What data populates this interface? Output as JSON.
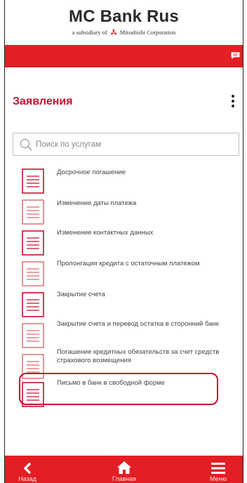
{
  "header": {
    "brand": "MC Bank Rus",
    "tagline_prefix": "a subsidiary of",
    "tagline_company": "Mitsubishi Corporation",
    "accent_color": "#e31e24"
  },
  "page": {
    "title": "Заявления",
    "menu_icon": "kebab-menu-icon"
  },
  "search": {
    "placeholder": "Поиск по услугам",
    "icon": "search-icon"
  },
  "applications": [
    {
      "label": "Досрочное погашение"
    },
    {
      "label": "Изменение даты платежа"
    },
    {
      "label": "Изменение контактных данных"
    },
    {
      "label": "Пролонгация кредита с остаточным платежом"
    },
    {
      "label": "Закрытие счета"
    },
    {
      "label": "Закрытие счета и перевод остатка в сторонний банк"
    },
    {
      "label": "Погашение кредитных обязательств за счет средств страхового возмещения"
    },
    {
      "label": "Письмо в банк в свободной форме"
    }
  ],
  "nav": {
    "back": "Назад",
    "home": "Главная",
    "menu": "Меню"
  }
}
